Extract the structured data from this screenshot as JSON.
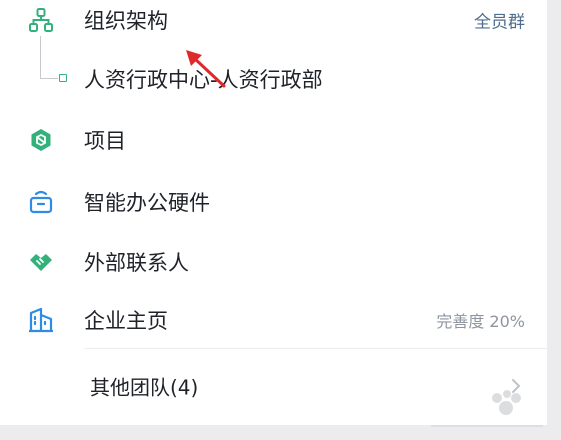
{
  "org": {
    "title": "组织架构",
    "badge": "全员群",
    "badge_color": "#4f6e8f",
    "department": "人资行政中心-人资行政部"
  },
  "menu": [
    {
      "label": "项目",
      "icon": "project-icon"
    },
    {
      "label": "智能办公硬件",
      "icon": "hardware-icon"
    },
    {
      "label": "外部联系人",
      "icon": "handshake-icon"
    },
    {
      "label": "企业主页",
      "icon": "building-icon",
      "right": "完善度 20%"
    }
  ],
  "other_teams": {
    "label": "其他团队(4)"
  },
  "colors": {
    "green": "#32b17b",
    "blue": "#2e8be6",
    "arrow": "#e0292b"
  }
}
